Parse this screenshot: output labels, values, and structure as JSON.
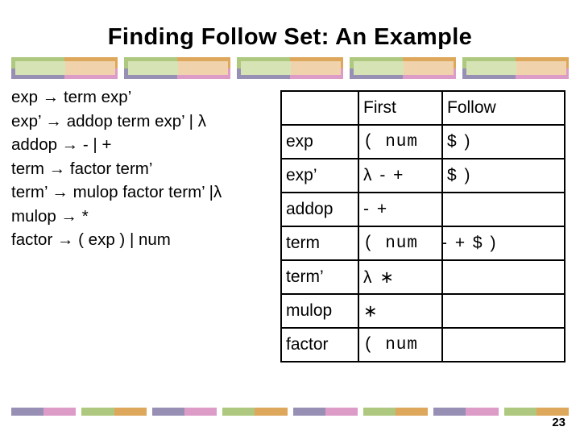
{
  "slide": {
    "title": "Finding Follow Set: An Example",
    "page_number": "23"
  },
  "grammar": {
    "lines": [
      {
        "lhs": "exp",
        "arrow": "→",
        "rhs": "term exp’"
      },
      {
        "lhs": "exp’",
        "arrow": "→",
        "rhs": "addop term exp’ | λ"
      },
      {
        "lhs": "addop",
        "arrow": "→",
        "rhs": "- | +"
      },
      {
        "lhs": "term",
        "arrow": "→",
        "rhs": "factor term’"
      },
      {
        "lhs": "term’",
        "arrow": "→",
        "rhs": "mulop factor term’ |λ"
      },
      {
        "lhs": "mulop",
        "arrow": "→",
        "rhs": "*"
      },
      {
        "lhs": "factor",
        "arrow": "→",
        "rhs": "( exp ) | num"
      }
    ]
  },
  "table": {
    "headers": {
      "name": "",
      "first": "First",
      "follow": "Follow"
    },
    "rows": [
      {
        "name": "exp",
        "first": "( num",
        "follow": "$ )"
      },
      {
        "name": "exp’",
        "first": "λ -  +",
        "follow": "$ )"
      },
      {
        "name": "addop",
        "first": "-  +",
        "follow": ""
      },
      {
        "name": "term",
        "first": "( num",
        "follow": "-  +  $   )"
      },
      {
        "name": "term’",
        "first": "λ ∗",
        "follow": ""
      },
      {
        "name": "mulop",
        "first": "∗",
        "follow": ""
      },
      {
        "name": "factor",
        "first": "( num",
        "follow": ""
      }
    ]
  },
  "decor": {
    "top_band_blocks": 5,
    "bottom_band_blocks": 8,
    "colors": {
      "green": "#aec97f",
      "green_light": "#d6e4b5",
      "orange": "#dda75c",
      "orange_light": "#f0d3ad",
      "purple": "#9890b4",
      "purple_light": "#c3bfd6",
      "pink": "#dd9cc8",
      "pink_light": "#eecbe0"
    }
  }
}
